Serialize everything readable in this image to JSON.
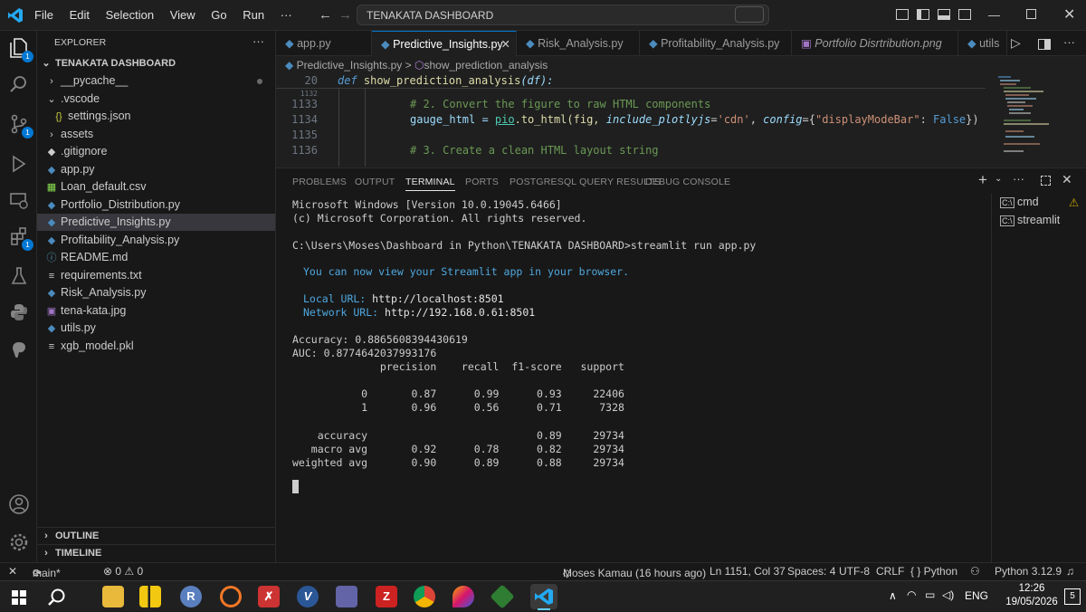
{
  "window": {
    "menu": [
      "File",
      "Edit",
      "Selection",
      "View",
      "Go",
      "Run"
    ],
    "more": "···",
    "search": "TENAKATA DASHBOARD"
  },
  "explorer": {
    "title": "EXPLORER",
    "more": "···",
    "root": "TENAKATA DASHBOARD",
    "items": [
      "__pycache__",
      ".vscode",
      "settings.json",
      "assets",
      ".gitignore",
      "app.py",
      "Loan_default.csv",
      "Portfolio_Distribution.py",
      "Predictive_Insights.py",
      "Profitability_Analysis.py",
      "README.md",
      "requirements.txt",
      "Risk_Analysis.py",
      "tena-kata.jpg",
      "utils.py",
      "xgb_model.pkl"
    ],
    "outline": "OUTLINE",
    "timeline": "TIMELINE"
  },
  "tabs": [
    "app.py",
    "Predictive_Insights.py",
    "Risk_Analysis.py",
    "Profitability_Analysis.py",
    "Portfolio Disrtribution.png",
    "utils"
  ],
  "breadcrumb": {
    "file": "Predictive_Insights.py",
    "sep": ">",
    "symbol": "show_prediction_analysis"
  },
  "editor": {
    "sticky_no": "20",
    "sticky_def": "def",
    "sticky_fn": "show_prediction_analysis",
    "sticky_arg": "(df):",
    "lines": [
      "1132",
      "1133",
      "1134",
      "1135",
      "1136"
    ],
    "c1": "# 2. Convert the figure to raw HTML components",
    "c2a": "gauge_html = ",
    "c2b": "pio",
    "c2c": ".to_html(fig, ",
    "c2d": "include_plotlyjs",
    "c2e": "=",
    "c2f": "'cdn'",
    "c2g": ", ",
    "c2h": "config",
    "c2i": "={",
    "c2j": "\"displayModeBar\"",
    "c2k": ": ",
    "c2l": "False",
    "c2m": "})",
    "c3": "# 3. Create a clean HTML layout string"
  },
  "panel": {
    "tabs": [
      "PROBLEMS",
      "OUTPUT",
      "TERMINAL",
      "PORTS",
      "POSTGRESQL QUERY RESULTS",
      "DEBUG CONSOLE"
    ],
    "terminals": [
      "cmd",
      "streamlit"
    ]
  },
  "terminal": {
    "l1": "Microsoft Windows [Version 10.0.19045.6466]",
    "l2": "(c) Microsoft Corporation. All rights reserved.",
    "l3": "C:\\Users\\Moses\\Dashboard in Python\\TENAKATA DASHBOARD>streamlit run app.py",
    "l4": "You can now view your Streamlit app in your browser.",
    "l5a": "Local URL: ",
    "l5b": "http://localhost:8501",
    "l6a": "Network URL: ",
    "l6b": "http://192.168.0.61:8501",
    "l7": "Accuracy: 0.8865608394430619",
    "l8": "AUC: 0.8774642037993176",
    "l9": "              precision    recall  f1-score   support",
    "l10": "           0       0.87      0.99      0.93     22406",
    "l11": "           1       0.96      0.56      0.71      7328",
    "l12": "    accuracy                           0.89     29734",
    "l13": "   macro avg       0.92      0.78      0.82     29734",
    "l14": "weighted avg       0.90      0.89      0.88     29734"
  },
  "status": {
    "branch": "main*",
    "errors": "⊗ 0 ⚠ 0",
    "blame": "Moses Kamau (16 hours ago)",
    "pos": "Ln 1151, Col 37",
    "spaces": "Spaces: 4",
    "enc": "UTF-8",
    "eol": "CRLF",
    "lang": "{ } Python",
    "interp": "Python 3.12.9"
  },
  "taskbar": {
    "lang": "ENG",
    "time": "12:26",
    "date": "19/05/2026",
    "notif": "5"
  }
}
